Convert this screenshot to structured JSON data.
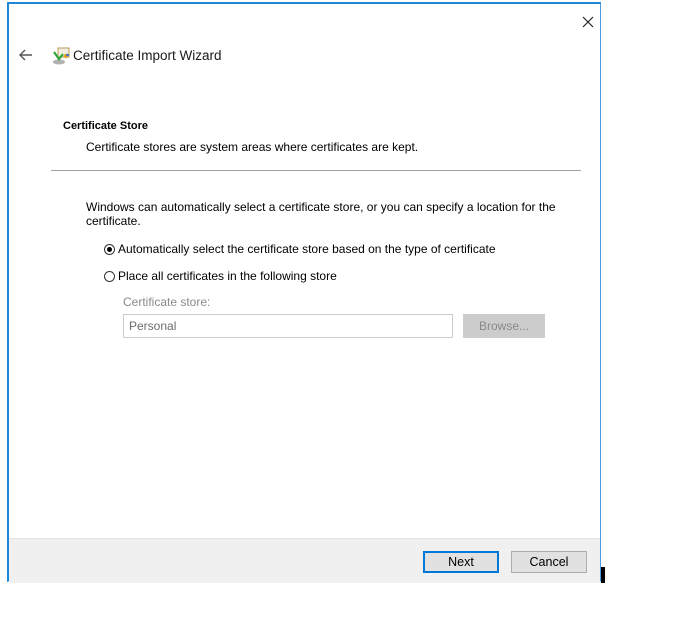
{
  "window": {
    "title": "Certificate Import Wizard",
    "icons": {
      "close": "close-icon",
      "back": "back-arrow-icon",
      "wizard": "certificate-wizard-icon"
    }
  },
  "section": {
    "title": "Certificate Store",
    "description": "Certificate stores are system areas where certificates are kept."
  },
  "body": {
    "intro": "Windows can automatically select a certificate store, or you can specify a location for the certificate.",
    "options": [
      {
        "label": "Automatically select the certificate store based on the type of certificate",
        "checked": true
      },
      {
        "label": "Place all certificates in the following store",
        "checked": false
      }
    ],
    "store_label": "Certificate store:",
    "store_value": "Personal",
    "browse_label": "Browse..."
  },
  "footer": {
    "next_label": "Next",
    "cancel_label": "Cancel"
  },
  "colors": {
    "accent": "#0078d7",
    "border": "#1e88d6",
    "footer_bg": "#f0f0f0"
  }
}
